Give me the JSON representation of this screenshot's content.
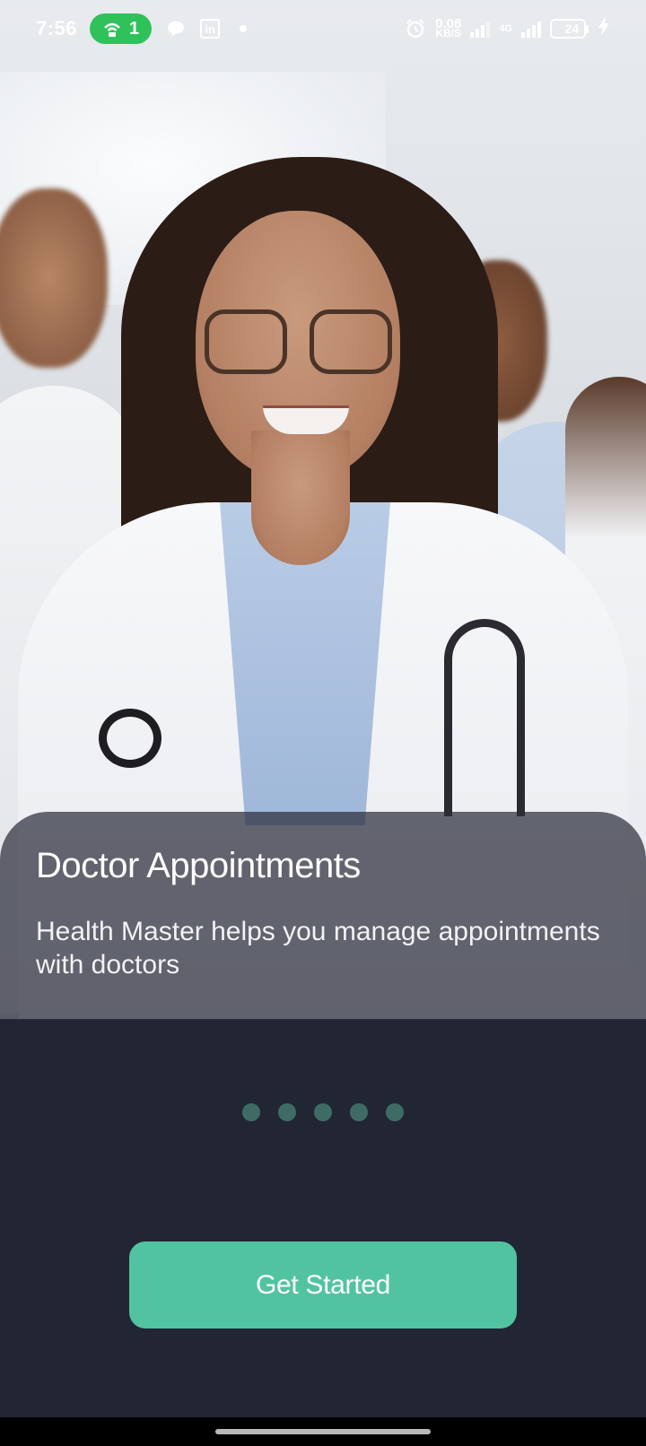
{
  "status_bar": {
    "time": "7:56",
    "hotspot_count": "1",
    "linkedin_icon_text": "in",
    "speed_value": "0.08",
    "speed_unit": "KB/S",
    "network_type": "4G",
    "battery_level": "24",
    "battery_fraction": 0.24
  },
  "onboarding": {
    "title": "Doctor Appointments",
    "description": "Health Master helps you manage appointments with doctors",
    "page_dots": 5
  },
  "cta": {
    "label": "Get Started"
  },
  "colors": {
    "background": "#222534",
    "accent": "#52c3a0",
    "dot": "#3e6c64",
    "hotspot": "#2fc25b"
  },
  "icons": [
    "hotspot-icon",
    "chat-bubble-icon",
    "linkedin-icon",
    "alarm-icon",
    "signal-icon",
    "battery-icon",
    "charging-icon"
  ]
}
